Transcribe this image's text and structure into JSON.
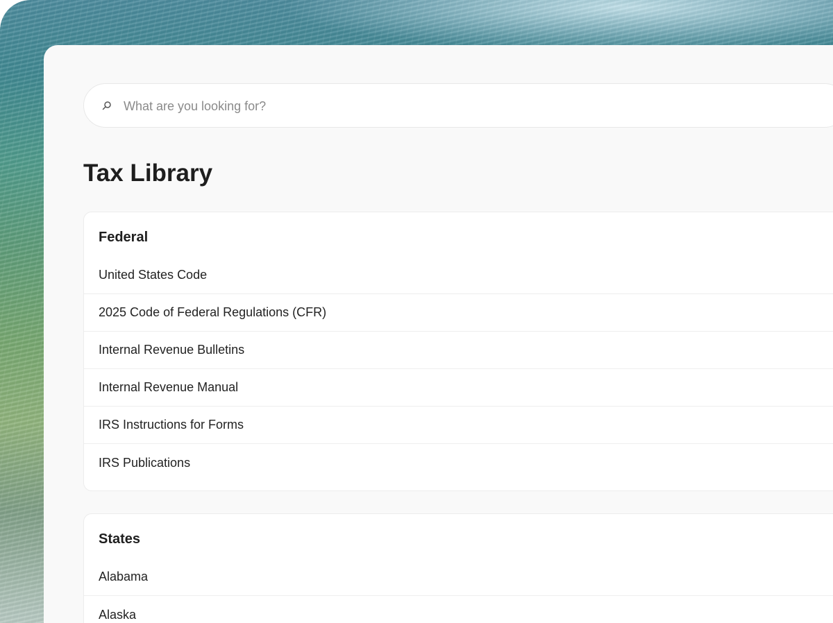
{
  "search": {
    "placeholder": "What are you looking for?",
    "value": ""
  },
  "page": {
    "title": "Tax Library"
  },
  "sections": {
    "federal": {
      "heading": "Federal",
      "items": [
        "United States Code",
        "2025 Code of Federal Regulations (CFR)",
        "Internal Revenue Bulletins",
        "Internal Revenue Manual",
        "IRS Instructions for Forms",
        "IRS Publications"
      ]
    },
    "states": {
      "heading": "States",
      "items": [
        "Alabama",
        "Alaska"
      ]
    }
  },
  "icons": {
    "search": "search-icon"
  },
  "colors": {
    "panel_bg": "#f9f9f9",
    "card_bg": "#ffffff",
    "text_primary": "#1e1e1e",
    "placeholder": "#8a8a8a"
  }
}
